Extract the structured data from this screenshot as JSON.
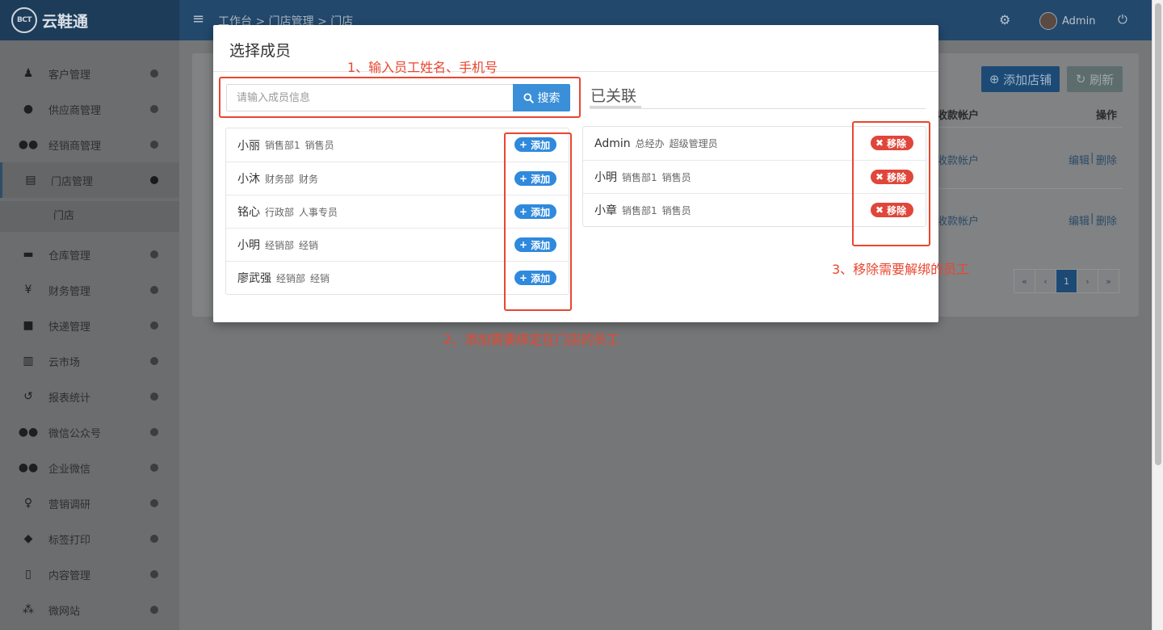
{
  "app": {
    "logo_mark": "BCT",
    "name": "云鞋通",
    "breadcrumb": "工作台 > 门店管理 > 门店",
    "user": "Admin"
  },
  "sidebar": {
    "items": [
      {
        "label": "客户管理",
        "icon": "person-icon"
      },
      {
        "label": "供应商管理",
        "icon": "user-icon"
      },
      {
        "label": "经销商管理",
        "icon": "users-icon"
      },
      {
        "label": "门店管理",
        "icon": "store-icon"
      },
      {
        "label": "仓库管理",
        "icon": "archive-icon"
      },
      {
        "label": "财务管理",
        "icon": "yen-icon"
      },
      {
        "label": "快递管理",
        "icon": "truck-icon"
      },
      {
        "label": "云市场",
        "icon": "building-icon"
      },
      {
        "label": "报表统计",
        "icon": "history-icon"
      },
      {
        "label": "微信公众号",
        "icon": "wechat-icon"
      },
      {
        "label": "企业微信",
        "icon": "wechat-work-icon"
      },
      {
        "label": "营销调研",
        "icon": "lightbulb-icon"
      },
      {
        "label": "标签打印",
        "icon": "tags-icon"
      },
      {
        "label": "内容管理",
        "icon": "file-icon"
      },
      {
        "label": "微网站",
        "icon": "sitemap-icon"
      }
    ],
    "sub_item": "门店"
  },
  "background_page": {
    "add_shop_button": "添加店铺",
    "refresh_button": "刷新",
    "col_account": "收款帐户",
    "col_actions": "操作",
    "rows": [
      {
        "account": "收款帐户",
        "edit": "编辑",
        "delete": "删除"
      },
      {
        "account": "收款帐户",
        "edit": "编辑",
        "delete": "删除"
      }
    ],
    "pagination": {
      "first": "«",
      "prev": "‹",
      "current": "1",
      "next": "›",
      "last": "»"
    }
  },
  "modal": {
    "title": "选择成员",
    "search": {
      "placeholder": "请输入成员信息",
      "button": "搜索"
    },
    "linked_title": "已关联",
    "add_label": "添加",
    "remove_label": "移除",
    "available_members": [
      {
        "name": "小丽",
        "dept": "销售部1",
        "role": "销售员"
      },
      {
        "name": "小沐",
        "dept": "财务部",
        "role": "财务"
      },
      {
        "name": "铭心",
        "dept": "行政部",
        "role": "人事专员"
      },
      {
        "name": "小明",
        "dept": "经销部",
        "role": "经销"
      },
      {
        "name": "廖武强",
        "dept": "经销部",
        "role": "经销"
      }
    ],
    "linked_members": [
      {
        "name": "Admin",
        "dept": "总经办",
        "role": "超级管理员"
      },
      {
        "name": "小明",
        "dept": "销售部1",
        "role": "销售员"
      },
      {
        "name": "小章",
        "dept": "销售部1",
        "role": "销售员"
      }
    ]
  },
  "annotations": {
    "step1": "1、输入员工姓名、手机号",
    "step2": "2、添加需要绑定在门店的员工",
    "step3": "3、移除需要解绑的员工",
    "color": "#e9462f"
  },
  "colors": {
    "primary": "#3a8fd8",
    "add_badge": "#2f89dc",
    "remove_badge": "#e0463a"
  }
}
